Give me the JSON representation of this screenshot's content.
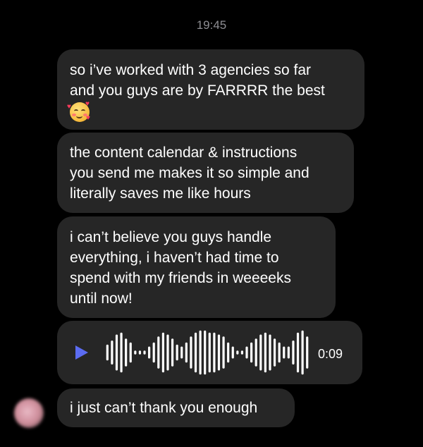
{
  "timestamp": "19:45",
  "messages": [
    {
      "lines": [
        "so i’ve worked with 3 agencies so far",
        "and you guys are by FARRRR the best"
      ],
      "emoji": "smiling-face-with-hearts"
    },
    {
      "lines": [
        "the content calendar & instructions",
        "you send me makes it so simple and",
        "literally saves me like hours"
      ]
    },
    {
      "lines": [
        "i can’t believe you guys handle",
        "everything, i haven’t had time to",
        "spend with my friends in weeeeks",
        "until now!"
      ]
    },
    {
      "lines": [
        "i just can’t thank you enough"
      ]
    }
  ],
  "voice_message": {
    "duration": "0:09",
    "play_color": "#5b6cf2",
    "waveform_levels": [
      0.33,
      0.5,
      0.75,
      0.83,
      0.58,
      0.42,
      0.08,
      0.08,
      0.08,
      0.25,
      0.42,
      0.67,
      0.83,
      0.75,
      0.58,
      0.33,
      0.25,
      0.42,
      0.67,
      0.83,
      0.92,
      0.92,
      0.83,
      0.83,
      0.75,
      0.67,
      0.42,
      0.25,
      0.08,
      0.08,
      0.25,
      0.42,
      0.58,
      0.75,
      0.83,
      0.75,
      0.58,
      0.42,
      0.25,
      0.25,
      0.5,
      0.83,
      0.92,
      0.67
    ]
  },
  "colors": {
    "background": "#000000",
    "bubble": "#262626",
    "timestamp": "#8e8e93",
    "text": "#ffffff"
  }
}
